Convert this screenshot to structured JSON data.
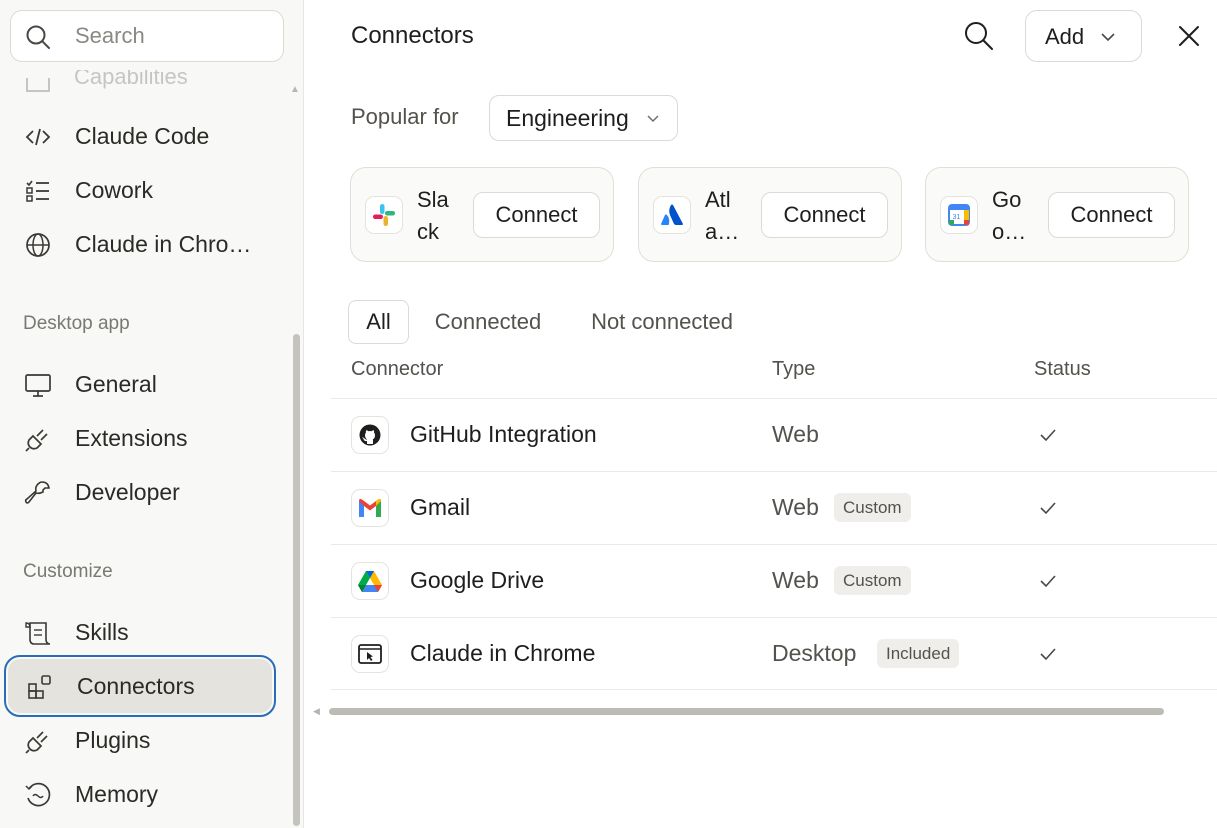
{
  "sidebar": {
    "search_placeholder": "Search",
    "cut_item_label": "Capabilities",
    "items_top": [
      {
        "label": "Claude Code",
        "icon": "code-icon"
      },
      {
        "label": "Cowork",
        "icon": "checklist-icon"
      },
      {
        "label": "Claude in Chro…",
        "icon": "globe-icon"
      }
    ],
    "section_desktop": "Desktop app",
    "items_desktop": [
      {
        "label": "General",
        "icon": "monitor-icon"
      },
      {
        "label": "Extensions",
        "icon": "plug-icon"
      },
      {
        "label": "Developer",
        "icon": "wrench-icon"
      }
    ],
    "section_customize": "Customize",
    "items_customize": [
      {
        "label": "Skills",
        "icon": "scroll-icon"
      },
      {
        "label": "Connectors",
        "icon": "blocks-icon",
        "active": true
      },
      {
        "label": "Plugins",
        "icon": "plug-icon"
      },
      {
        "label": "Memory",
        "icon": "memory-icon"
      }
    ]
  },
  "header": {
    "title": "Connectors",
    "add_label": "Add"
  },
  "popular": {
    "label": "Popular for",
    "selected": "Engineering",
    "cards": [
      {
        "name": "Slack",
        "connect_label": "Connect",
        "icon": "slack-icon"
      },
      {
        "name": "Atl a…",
        "connect_label": "Connect",
        "icon": "atlassian-icon"
      },
      {
        "name": "Go o…",
        "connect_label": "Connect",
        "icon": "google-calendar-icon"
      }
    ]
  },
  "tabs": [
    "All",
    "Connected",
    "Not connected"
  ],
  "table": {
    "headers": {
      "connector": "Connector",
      "type": "Type",
      "status": "Status"
    },
    "rows": [
      {
        "name": "GitHub Integration",
        "type": "Web",
        "badge": "",
        "status": "connected",
        "icon": "github-icon"
      },
      {
        "name": "Gmail",
        "type": "Web",
        "badge": "Custom",
        "status": "connected",
        "icon": "gmail-icon"
      },
      {
        "name": "Google Drive",
        "type": "Web",
        "badge": "Custom",
        "status": "connected",
        "icon": "google-drive-icon"
      },
      {
        "name": "Claude in Chrome",
        "type": "Desktop",
        "badge": "Included",
        "status": "connected",
        "icon": "chrome-window-icon"
      }
    ]
  },
  "colors": {
    "active_outline": "#2a6cb8",
    "sidebar_bg": "#f8f8f6"
  }
}
